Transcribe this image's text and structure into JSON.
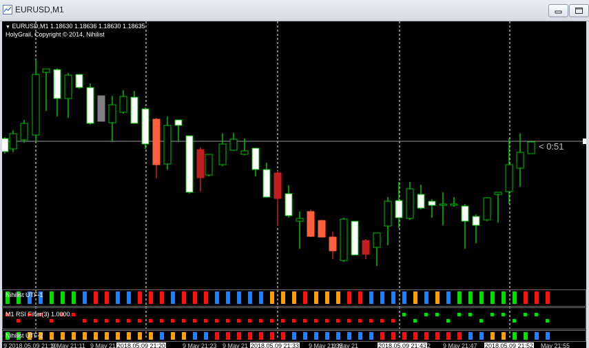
{
  "window": {
    "title": "EURUSD,M1",
    "buttons": [
      "minimize",
      "maximize"
    ]
  },
  "chart": {
    "symbol_line": "EURUSD,M1  1.18630 1.18636 1.18630 1.18635",
    "indicator_line": "HolyGrail, Copyright © 2014, Nihilist",
    "countdown": "< 0:51",
    "colors": {
      "background": "#000000",
      "bull_green_outline": "#00c000",
      "bull_white_body": "#ffffff",
      "bear_body": "#ff6040",
      "bear_dark": "#c02020",
      "neutral_gray": "#808080",
      "price_line": "#9aa0a6",
      "utf_green": "#00e000",
      "utf_blue": "#2080ff",
      "utf_orange": "#ffa000",
      "utf_red": "#ff1010"
    }
  },
  "subwindows": [
    {
      "label": "Nihilist UTF-1"
    },
    {
      "label": "M1 RSI Filter(3) 1.0000"
    },
    {
      "label": "Nihilist UTF-2"
    }
  ],
  "time_axis": [
    {
      "text": "9 2018.05.09 21:10",
      "highlight": false
    },
    {
      "text": "9 May 21:11",
      "highlight": false
    },
    {
      "text": "9 May 21:19",
      "highlight": false
    },
    {
      "text": "2018.05.09 21:20",
      "highlight": true
    },
    {
      "text": "9 May 21:23",
      "highlight": false
    },
    {
      "text": "9 May 21",
      "highlight": false
    },
    {
      "text": "2018.05.09 21:33",
      "highlight": true
    },
    {
      "text": "9 May 21:35",
      "highlight": false
    },
    {
      "text": "9 May 21",
      "highlight": false
    },
    {
      "text": "2018.05.09 21:43",
      "highlight": true
    },
    {
      "text": "42",
      "highlight": false
    },
    {
      "text": "9 May 21:47",
      "highlight": false
    },
    {
      "text": "2018.05.09 21:52",
      "highlight": true
    },
    {
      "text": "May 21:55",
      "highlight": false
    }
  ]
}
